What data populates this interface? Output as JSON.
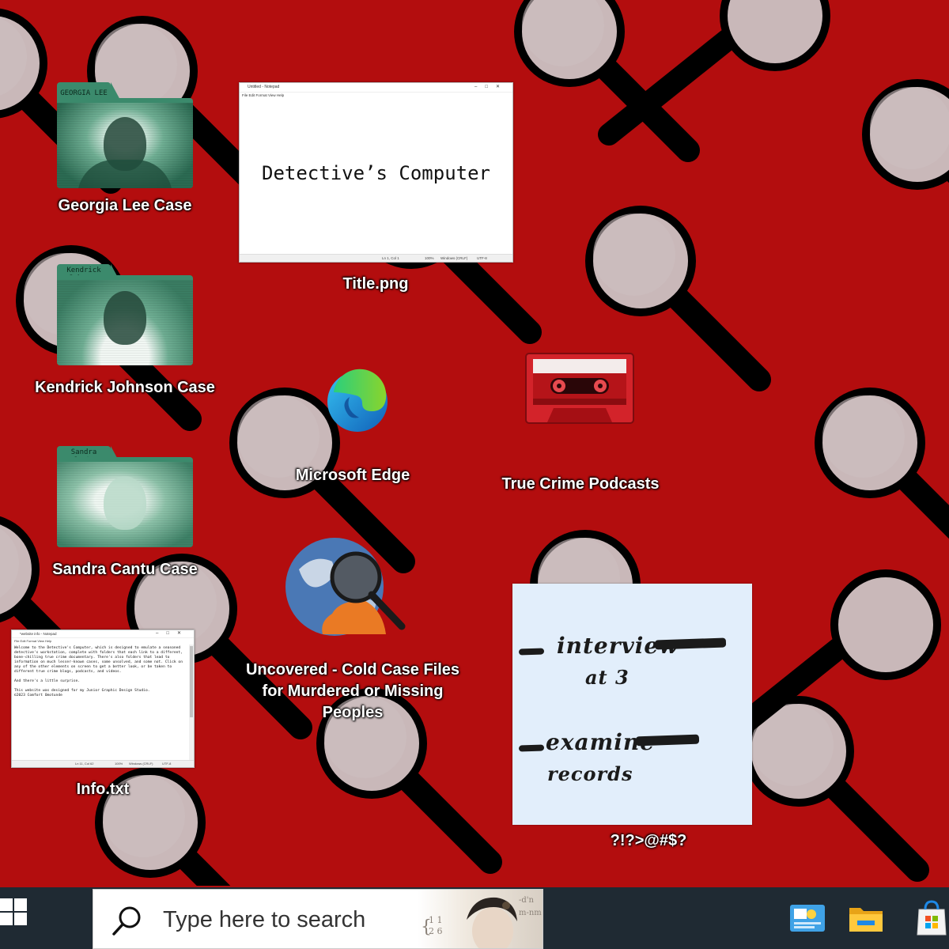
{
  "desktop": {
    "icons": {
      "georgia": {
        "tab": "GEORGIA LEE",
        "label": "Georgia Lee Case"
      },
      "kendrick": {
        "tab": "Kendrick\nJohnson",
        "label": "Kendrick Johnson Case"
      },
      "sandra": {
        "tab": "Sandra\nCantu",
        "label": "Sandra Cantu Case"
      },
      "title_png": {
        "label": "Title.png",
        "heading": "Detective’s Computer"
      },
      "edge": {
        "label": "Microsoft Edge"
      },
      "podcasts": {
        "label": "True Crime Podcasts"
      },
      "uncovered": {
        "label_line1": "Uncovered - Cold Case Files",
        "label_line2": "for Murdered or Missing",
        "label_line3": "Peoples"
      },
      "info": {
        "label": "Info.txt"
      },
      "sticky": {
        "label": "?!?>@#$?",
        "line1": "interview",
        "line2": "at 3",
        "line3": "examine",
        "line4": "records"
      }
    }
  },
  "notepad_title": {
    "window_title": "Untitled - Notepad",
    "menu": "File  Edit  Format  View  Help",
    "status": {
      "pos": "Ln 1, Col 1",
      "zoom": "100%",
      "eol": "Windows (CRLF)",
      "enc": "UTF-8"
    }
  },
  "notepad_info": {
    "window_title": "*website info - Notepad",
    "menu": "File  Edit  Format  View  Help",
    "body": "Welcome to the Detective's Computer, which is designed to emulate a seasoned detective's workstation, complete with folders that each link to a different, bone-chilling true crime documentary. There's also folders that lead to information on much lesser-known cases, some unsolved, and some not. Click on any of the other elements on screen to get a better look, or be taken to different true crime blogs, podcasts, and videos.\n\nAnd there's a little surprise.\n\nThis website was designed for my Junior Graphic Design Studio.\n©2023 Comfort Omotunde",
    "status": {
      "pos": "Ln 11, Col 62",
      "zoom": "100%",
      "eol": "Windows (CRLF)",
      "enc": "UTF-8"
    }
  },
  "taskbar": {
    "search_placeholder": "Type here to search",
    "icons": [
      "windows-start-icon",
      "search-icon",
      "news-widget-icon",
      "file-explorer-icon",
      "store-icon"
    ]
  },
  "colors": {
    "wallpaper": "#b30d0e",
    "taskbar": "#1f2a33",
    "folder": "#3b8a6c",
    "sticky": "#e2eefb"
  }
}
